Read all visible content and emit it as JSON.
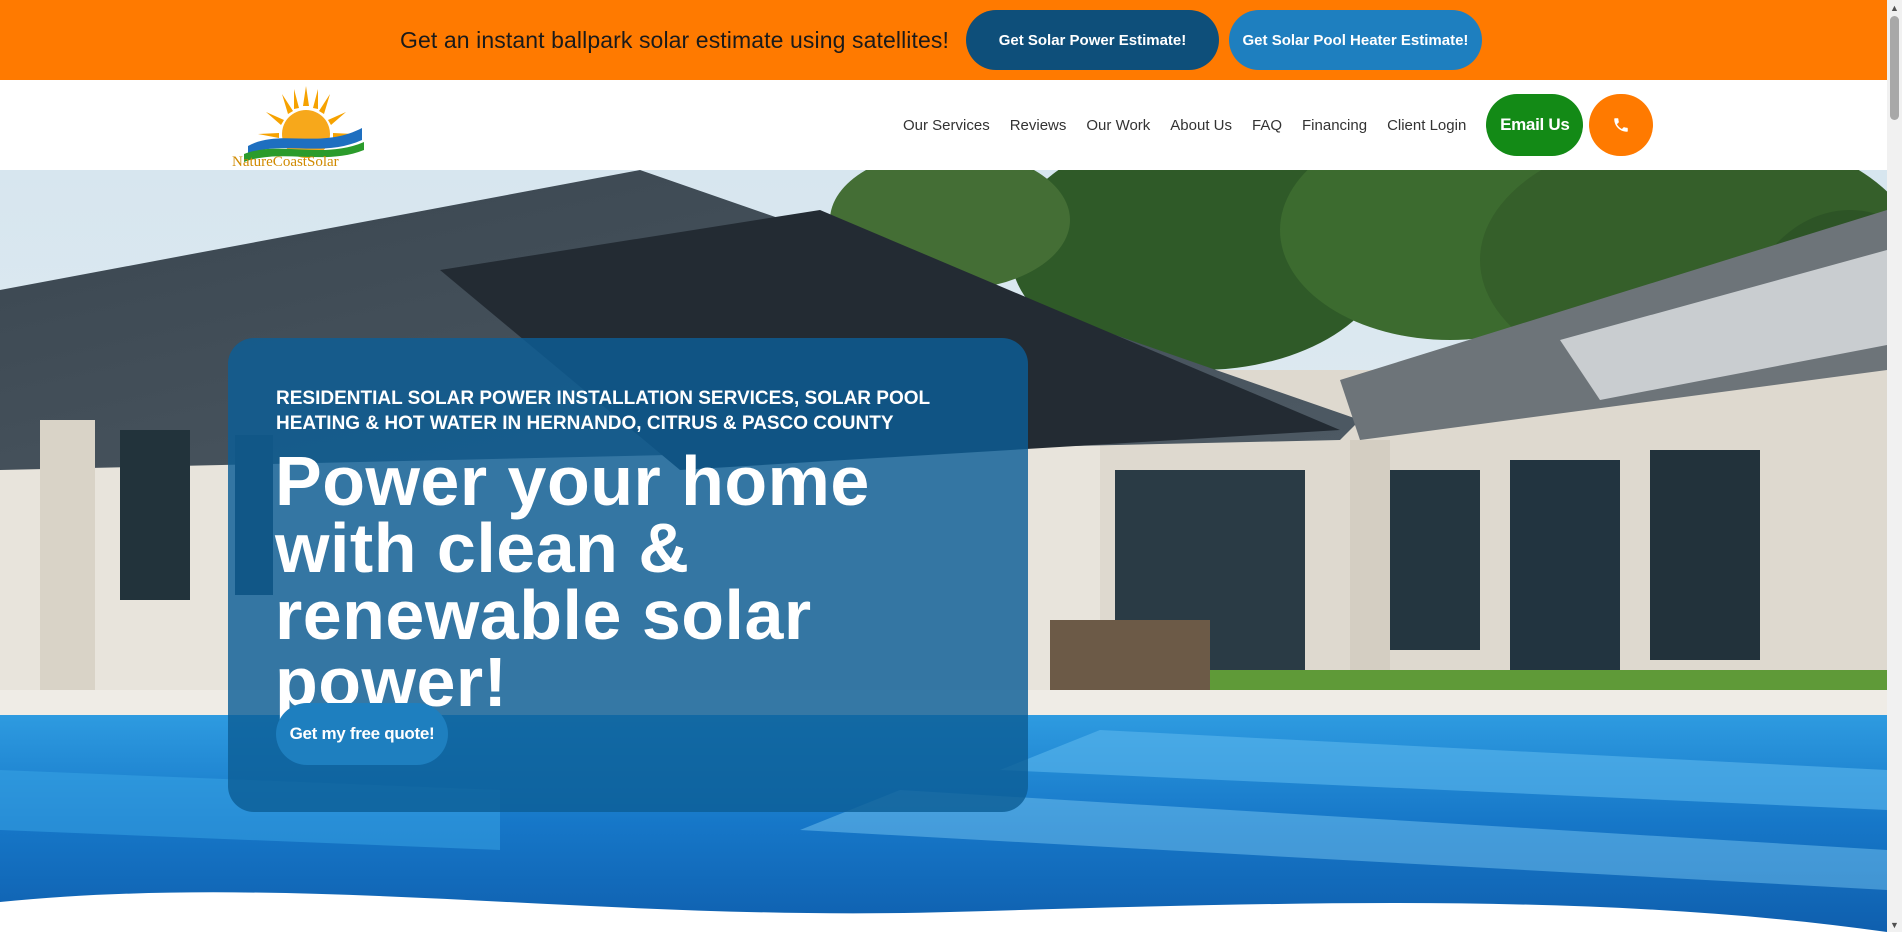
{
  "promo": {
    "text": "Get an instant ballpark solar estimate using satellites!",
    "power_button": "Get Solar Power Estimate!",
    "pool_button": "Get Solar Pool Heater Estimate!"
  },
  "brand": {
    "logo_text": "NatureCoastSolar"
  },
  "nav": {
    "items": [
      "Our Services",
      "Reviews",
      "Our Work",
      "About Us",
      "FAQ",
      "Financing",
      "Client Login"
    ],
    "email_label": "Email Us",
    "phone_icon": "phone-icon"
  },
  "hero": {
    "eyebrow": "RESIDENTIAL SOLAR POWER INSTALLATION SERVICES, SOLAR POOL HEATING & HOT WATER IN HERNANDO, CITRUS & PASCO COUNTY",
    "headline": "Power your home with clean & renewable solar power!",
    "cta": "Get my free quote!"
  },
  "colors": {
    "promo_bg": "#ff7a00",
    "primary_dark": "#0e4f7a",
    "primary": "#1e7fbf",
    "email_green": "#138a16",
    "card_bg": "#0c5e96"
  }
}
